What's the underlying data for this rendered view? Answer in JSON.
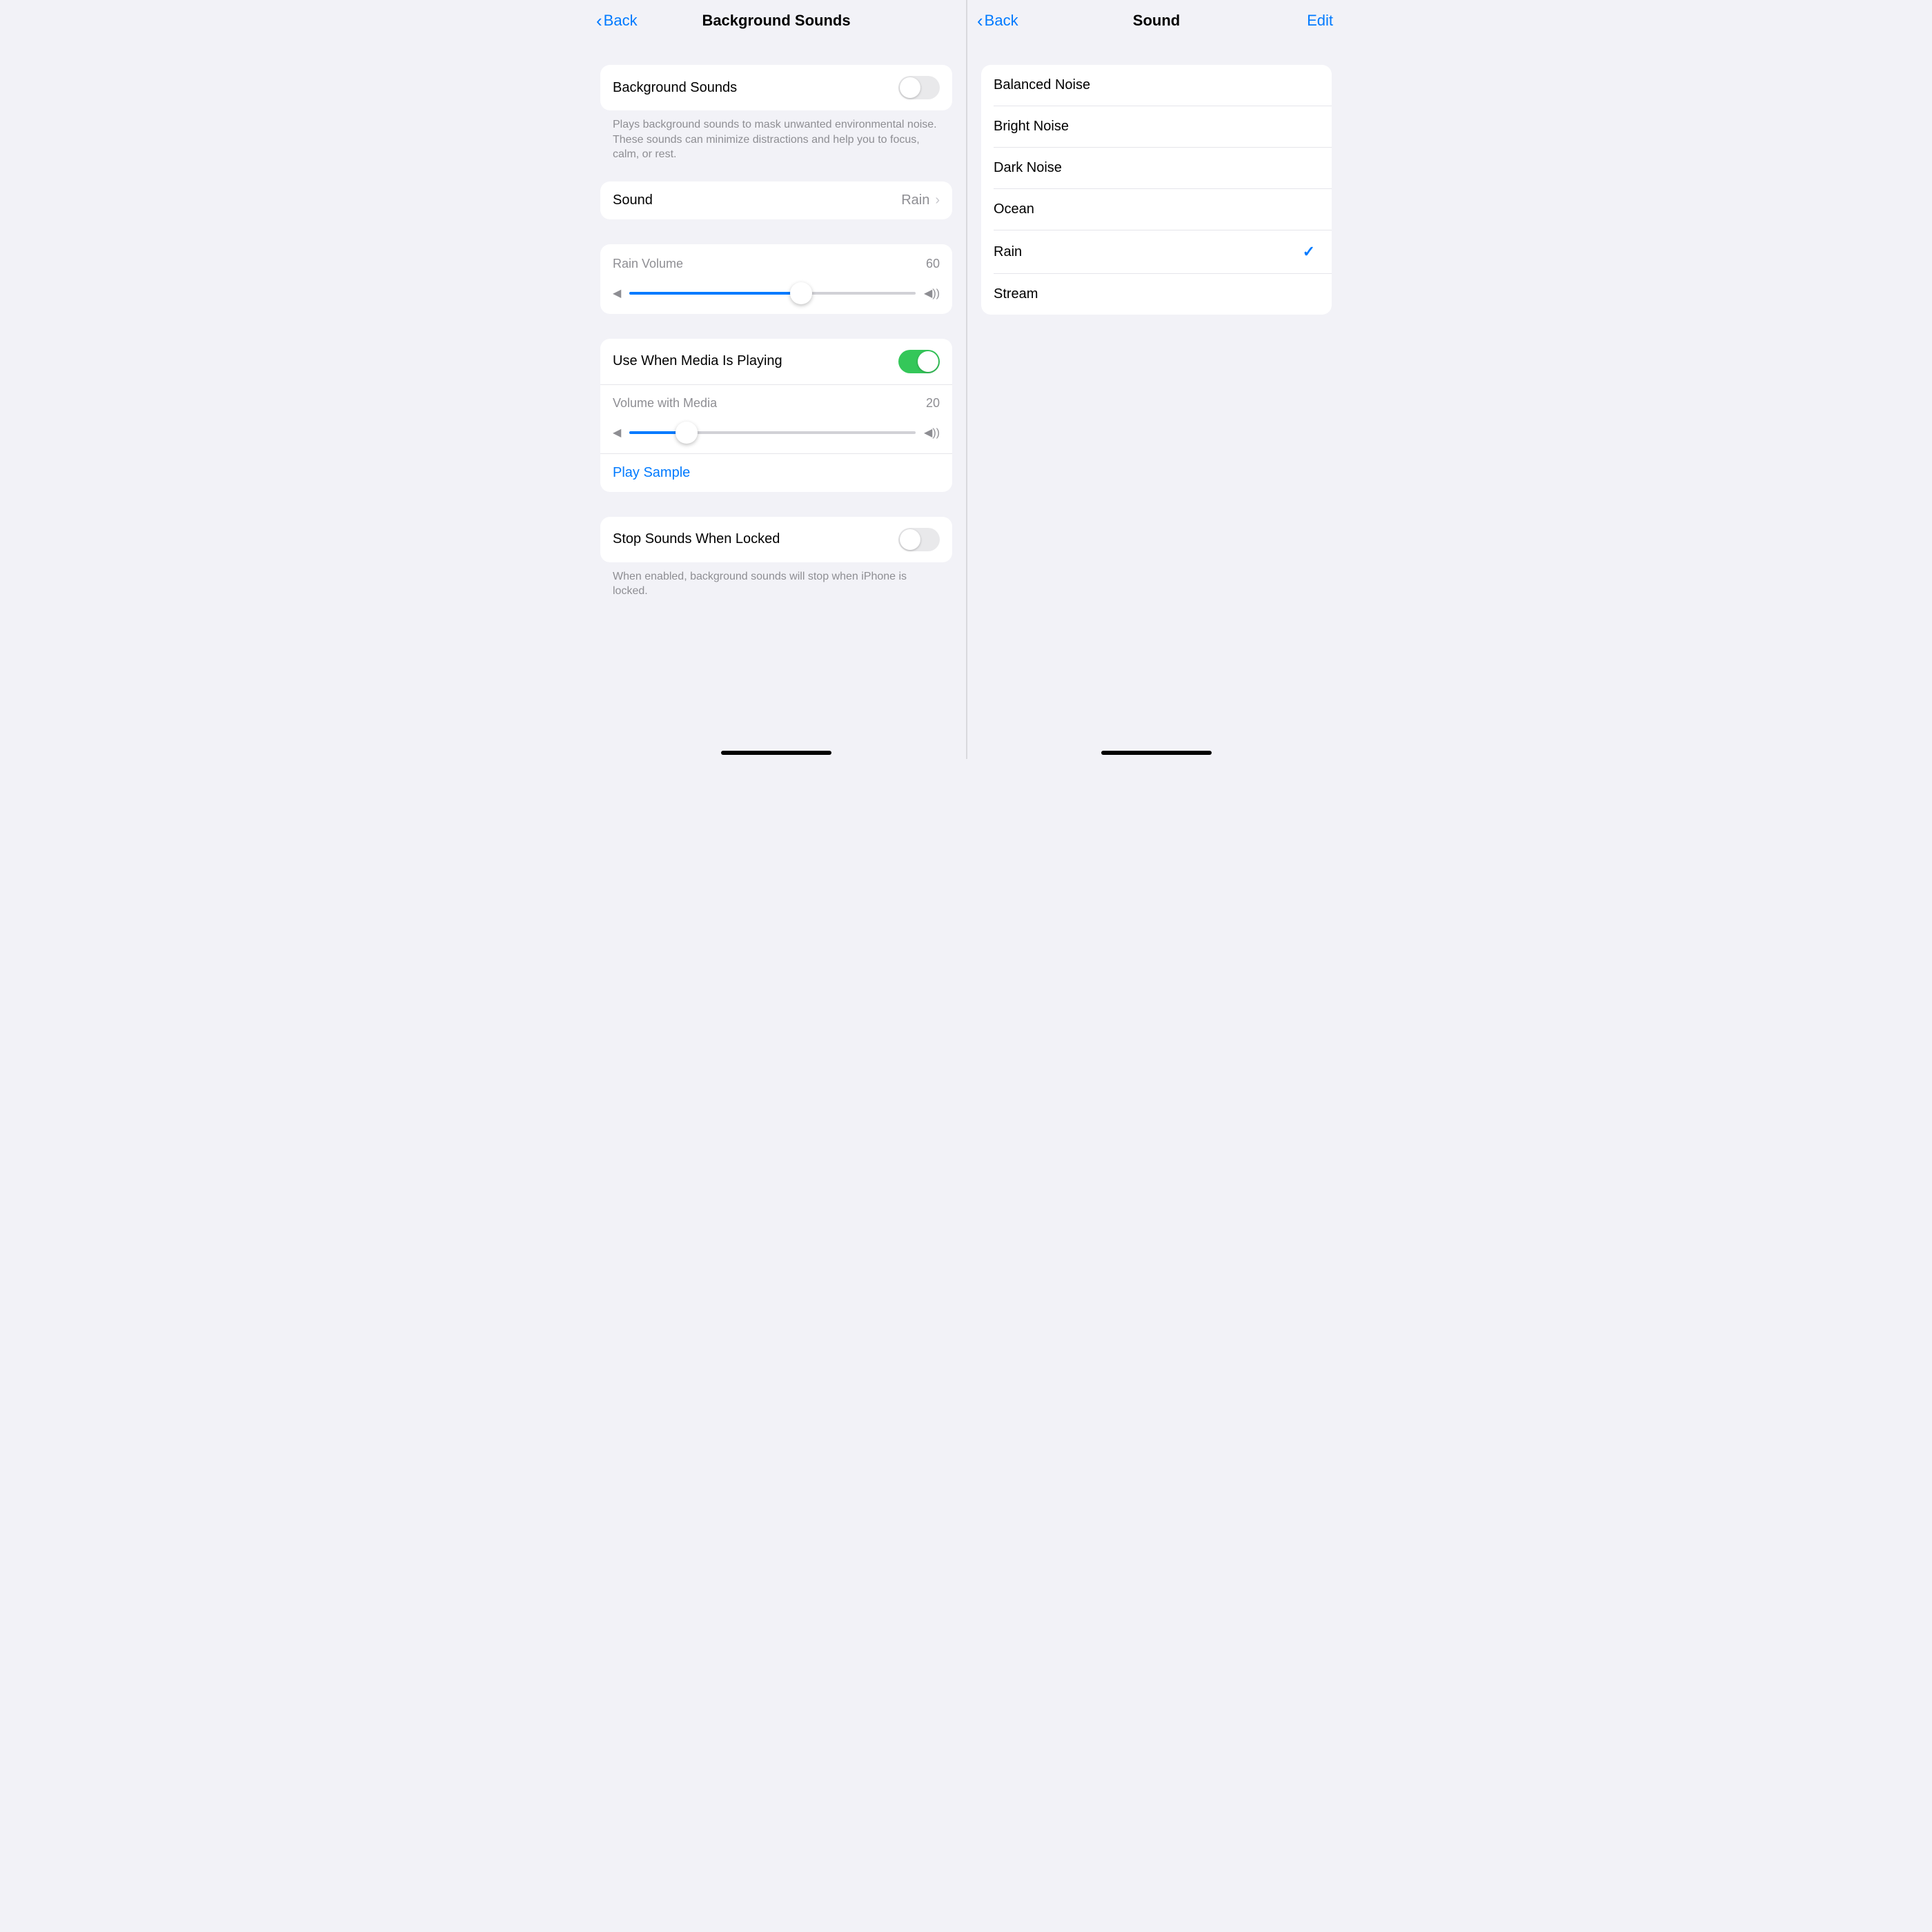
{
  "left": {
    "back_label": "Back",
    "title": "Background Sounds",
    "main_toggle": {
      "label": "Background Sounds",
      "on": false
    },
    "main_footer": "Plays background sounds to mask unwanted environmental noise. These sounds can minimize distractions and help you to focus, calm, or rest.",
    "sound_row": {
      "label": "Sound",
      "value": "Rain"
    },
    "volume1": {
      "label": "Rain Volume",
      "value": 60
    },
    "media_toggle": {
      "label": "Use When Media Is Playing",
      "on": true
    },
    "volume2": {
      "label": "Volume with Media",
      "value": 20
    },
    "play_sample": "Play Sample",
    "stop_toggle": {
      "label": "Stop Sounds When Locked",
      "on": false
    },
    "stop_footer": "When enabled, background sounds will stop when iPhone is locked."
  },
  "right": {
    "back_label": "Back",
    "title": "Sound",
    "edit_label": "Edit",
    "options": [
      {
        "label": "Balanced Noise",
        "selected": false
      },
      {
        "label": "Bright Noise",
        "selected": false
      },
      {
        "label": "Dark Noise",
        "selected": false
      },
      {
        "label": "Ocean",
        "selected": false
      },
      {
        "label": "Rain",
        "selected": true
      },
      {
        "label": "Stream",
        "selected": false
      }
    ]
  }
}
